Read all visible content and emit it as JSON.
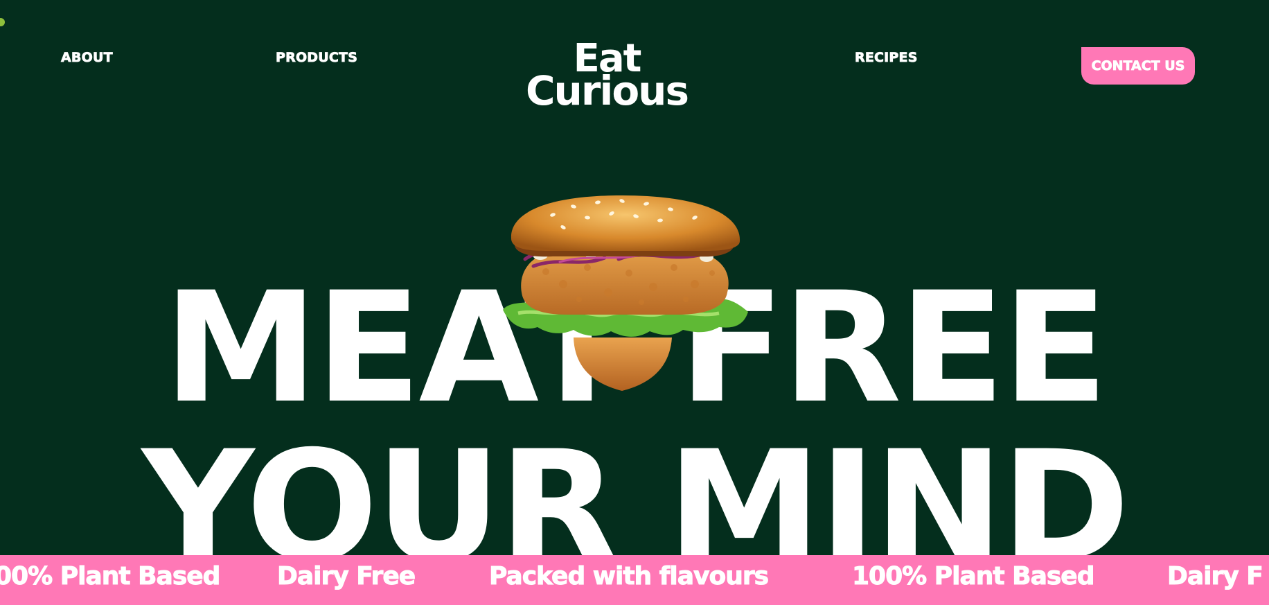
{
  "nav": {
    "about": "ABOUT",
    "products": "PRODUCTS",
    "recipes": "RECIPES",
    "contact": "CONTACT US"
  },
  "logo": {
    "line1": "Eat",
    "line2": "Curious"
  },
  "hero": {
    "line1": "MEAT FREE",
    "line2": "YOUR MIND",
    "image": "burger-image"
  },
  "ticker": {
    "items": [
      "00% Plant Based",
      "Dairy Free",
      "Packed with flavours",
      "100% Plant Based",
      "Dairy F"
    ]
  },
  "colors": {
    "background": "#042e1d",
    "accent_pink": "#ff78b6",
    "text": "#ffffff",
    "indicator_dot": "#8fbf3c"
  }
}
